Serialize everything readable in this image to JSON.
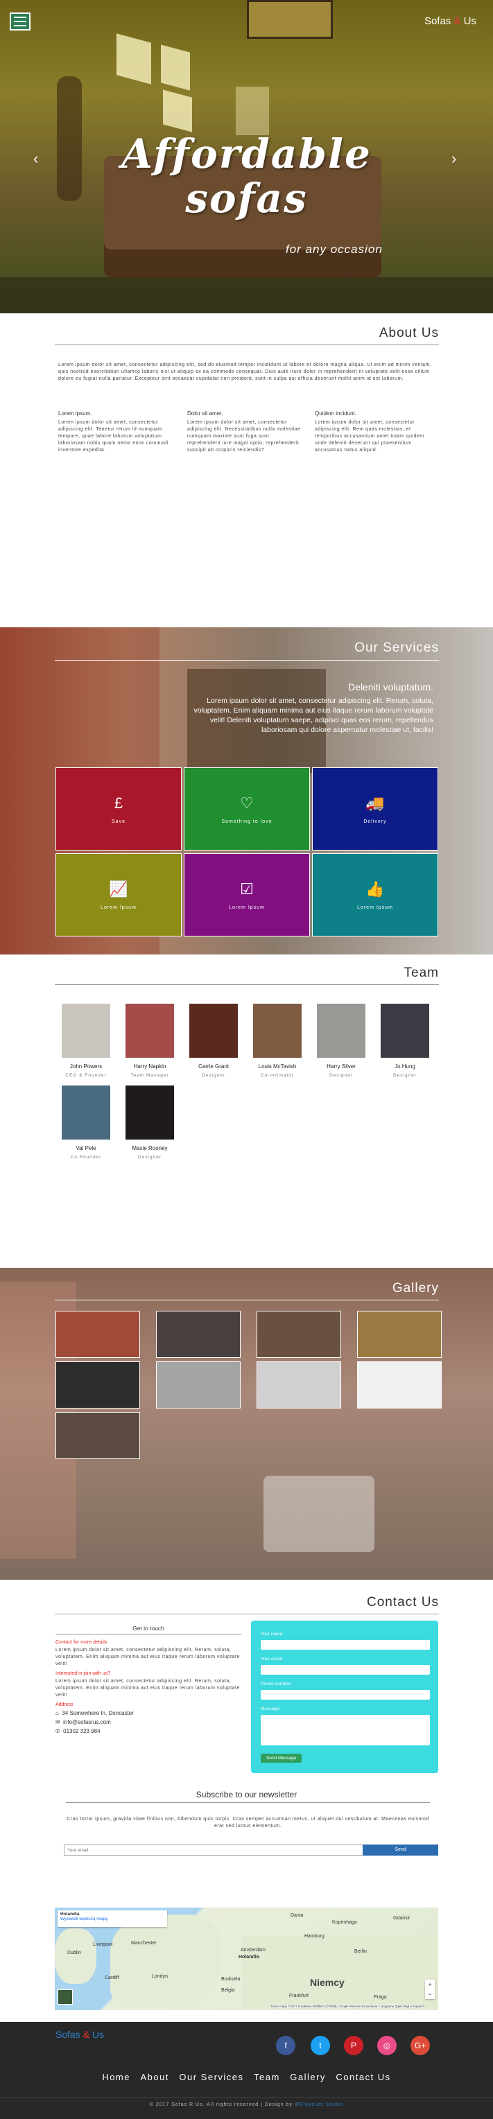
{
  "header": {
    "brand_pre": "Sofas ",
    "brand_amp": "&",
    "brand_post": " Us",
    "hero_title_1": "Affordable",
    "hero_title_2": "sofas",
    "hero_subtitle": "for any occasion",
    "prev_arrow": "‹",
    "next_arrow": "›"
  },
  "about": {
    "heading": "About Us",
    "intro": "Lorem ipsum dolor sit amet, consectetur adipiscing elit, sed do eiusmod tempor incididunt ut labore et dolore magna aliqua. Ut enim ad minim veniam, quis nostrud exercitation ullamco laboris nisi ut aliquip ex ea commodo consequat. Duis aute irure dolor in reprehenderit in voluptate velit esse cillum dolore eu fugiat nulla pariatur. Excepteur sint occaecat cupidatat non proident, sunt in culpa qui officia deserunt mollit anim id est laborum.",
    "columns": [
      {
        "title": "Lorem ipsum.",
        "text": "Lorem ipsum dolor sit amet, consectetur adipiscing elit. Tenetur rerum id numquam tempore, quae labore laborum voluptatum laboriosam nobis quam nemo enim commodi inventore expedita."
      },
      {
        "title": "Dolor sit amet.",
        "text": "Lorem ipsum dolor sit amet, consectetur adipiscing elit. Necessitatibus nulla molestiae numquam maxime sunt fuga sunt reprehenderit iure magni optio, reprehenderit suscipit ab corporis reiciendis?"
      },
      {
        "title": "Quidem incidunt.",
        "text": "Lorem ipsum dolor sit amet, consectetur adipiscing elit. Rem quas molestias, et temporibus accusantium amet totam quidem unde deleniti deserunt qui praesentium accusamus natus aliquid."
      }
    ]
  },
  "services": {
    "heading": "Our Services",
    "sub_heading": "Deleniti voluptatum.",
    "text": "Lorem ipsum dolor sit amet, consectetur adipiscing elit. Rerum, soluta, voluptatem. Enim aliquam minima aut eius itaque rerum laborum voluptate velit! Deleniti voluptatum saepe, adipisci quas eos rerum, repellendus laboriosam qui dolore aspernatur molestiae ut, facilis!",
    "tiles": [
      {
        "label": "Save",
        "glyph": "£",
        "color": "#a8182a"
      },
      {
        "label": "Something to love",
        "glyph": "♡",
        "color": "#1f8f2f"
      },
      {
        "label": "Delivery",
        "glyph": "🚚",
        "color": "#0e1c88"
      },
      {
        "label": "Lorem Ipsum",
        "glyph": "📈",
        "color": "#8c8d16"
      },
      {
        "label": "Lorem Ipsum",
        "glyph": "☑",
        "color": "#820f82"
      },
      {
        "label": "Lorem Ipsum",
        "glyph": "👍",
        "color": "#0d8088"
      }
    ]
  },
  "team": {
    "heading": "Team",
    "members": [
      {
        "name": "John Powers",
        "role": "CEO & Founder",
        "tone": "#c9c4bd"
      },
      {
        "name": "Harry Napkin",
        "role": "Team Manager",
        "tone": "#a34c4a"
      },
      {
        "name": "Carrie Grant",
        "role": "Designer",
        "tone": "#5a2a1e"
      },
      {
        "name": "Louis McTavish",
        "role": "Co-ordinator",
        "tone": "#7e5a40"
      },
      {
        "name": "Harry Silver",
        "role": "Designer",
        "tone": "#9a9894"
      },
      {
        "name": "Jo Hung",
        "role": "Designer",
        "tone": "#3c3a44"
      },
      {
        "name": "Val Pele",
        "role": "Co-Founder",
        "tone": "#4a6a80"
      },
      {
        "name": "Maxie Rooney",
        "role": "Designer",
        "tone": "#1f1b1a"
      }
    ]
  },
  "gallery": {
    "heading": "Gallery",
    "images": [
      {
        "tone": "#a04a3a"
      },
      {
        "tone": "#4a4040"
      },
      {
        "tone": "#6a5040"
      },
      {
        "tone": "#9a7a40"
      },
      {
        "tone": "#2c2c2c"
      },
      {
        "tone": "#a4a4a4"
      },
      {
        "tone": "#d0d0d0"
      },
      {
        "tone": "#f0f0f0"
      },
      {
        "tone": "#5a4a40"
      }
    ]
  },
  "contact": {
    "heading": "Contact Us",
    "get_in_touch": "Get in touch",
    "more_details_label": "Contact for more details",
    "more_details_text": "Lorem ipsum dolor sit amet, consectetur adipiscing elit. Rerum, soluta, voluptatem. Enim aliquam minima aut eius itaque rerum laborum voluptate velit!",
    "interested_label": "Interested in join with us?",
    "interested_text": "Lorem ipsum dolor sit amet, consectetur adipiscing elit. Rerum, soluta, voluptatem. Enim aliquam minima aut eius itaque rerum laborum voluptate velit!",
    "address_label": "Address",
    "address": "34 Somewhere In, Doncaster",
    "email": "info@sofasrus.com",
    "phone": "01302 323 984",
    "form": {
      "name_label": "Your name:",
      "email_label": "Your email:",
      "phone_label": "Phone number:",
      "message_label": "Message:",
      "send_label": "Send Message"
    }
  },
  "newsletter": {
    "heading": "Subscribe to our newsletter",
    "text": "Cras tortor ipsum, gravida vitae finibus non, bibendum quis turpis. Cras semper accumsan metus, ut aliquet dui vestibulum at. Maecenas euismod erat sed luctus elementum.",
    "placeholder": "Your email",
    "send_label": "Send"
  },
  "map": {
    "popup_title": "Holandia",
    "popup_link": "Wyświetl większą mapę",
    "labels": [
      "Liverpool",
      "Manchester",
      "Dublin",
      "Cardiff",
      "Londyn",
      "Holandia",
      "Amsterdam",
      "Bruksela",
      "Belgia",
      "Niemcy",
      "Berlin",
      "Hamburg",
      "Gdańsk",
      "Dania",
      "Kopenhaga",
      "Frankfurt",
      "Praga"
    ],
    "zoom_in": "+",
    "zoom_out": "−",
    "attribution": "Dane mapy ©2017 GeoBasis-DE/BKG (©2009), Google  Warunki korzystania z programu  Zgłoś błąd w mapach"
  },
  "footer": {
    "brand_pre": "Sofas ",
    "brand_amp": "&",
    "brand_post": " Us",
    "nav": [
      "Home",
      "About",
      "Our Services",
      "Team",
      "Gallery",
      "Contact Us"
    ],
    "copyright": "© 2017 Sofas R Us. All rights reserved | Design by ",
    "designer": "W3layouts Studio",
    "social": [
      {
        "name": "facebook",
        "glyph": "f",
        "color": "#3b5998"
      },
      {
        "name": "twitter",
        "glyph": "t",
        "color": "#1da1f2"
      },
      {
        "name": "pinterest",
        "glyph": "P",
        "color": "#cb2027"
      },
      {
        "name": "dribbble",
        "glyph": "◎",
        "color": "#ea4c89"
      },
      {
        "name": "google-plus",
        "glyph": "G+",
        "color": "#dd4b39"
      }
    ]
  }
}
